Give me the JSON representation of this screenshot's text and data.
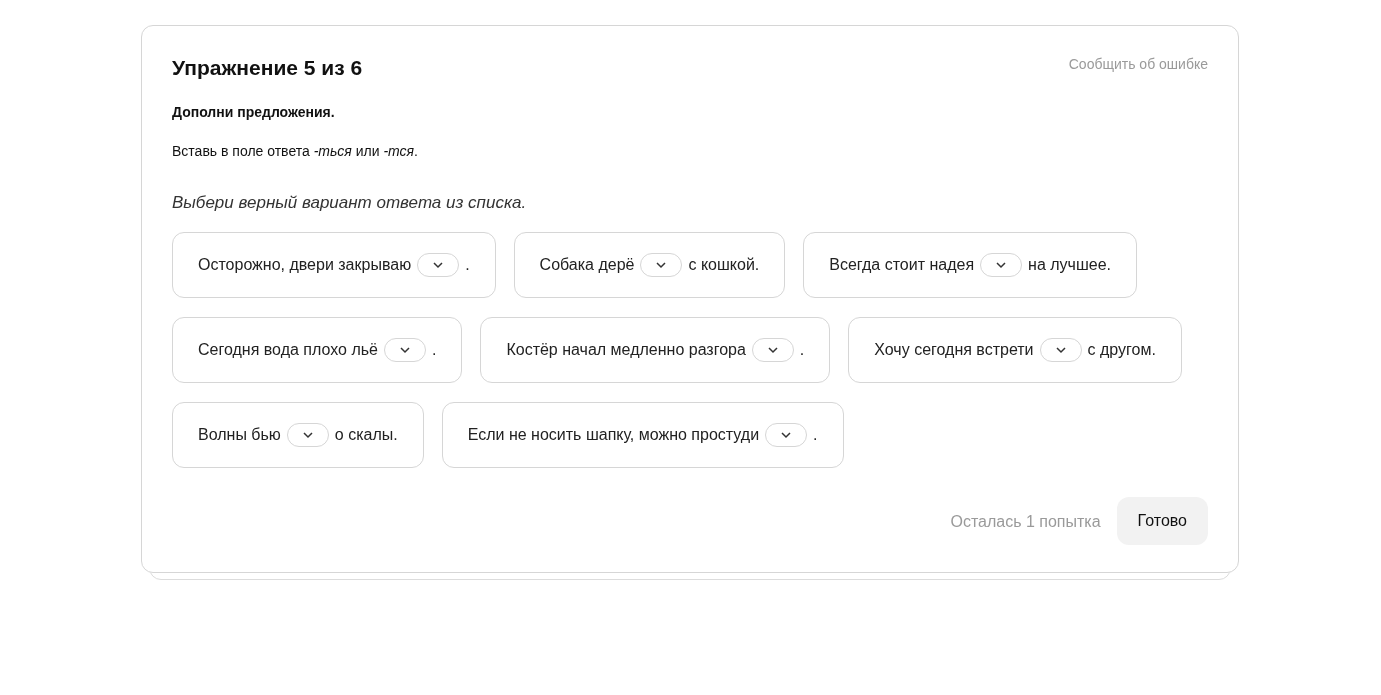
{
  "title": "Упражнение 5 из 6",
  "report_link": "Сообщить об ошибке",
  "task": "Дополни предложения.",
  "instruction": "Вставь в поле ответа *-ться* или *-тся*.",
  "hint": "Выбери верный вариант ответа из списка.",
  "rows": [
    [
      {
        "before": "Осторожно, двери закрываю",
        "after": "."
      },
      {
        "before": "Собака дерё",
        "after": "с кошкой."
      },
      {
        "before": "Всегда стоит надея",
        "after": "на лучшее."
      }
    ],
    [
      {
        "before": "Сегодня вода плохо льё",
        "after": "."
      },
      {
        "before": "Костёр начал медленно разгора",
        "after": "."
      },
      {
        "before": "Хочу сегодня встрети",
        "after": "с другом."
      }
    ],
    [
      {
        "before": "Волны бью",
        "after": "о скалы."
      },
      {
        "before": "Если не носить шапку, можно простуди",
        "after": "."
      }
    ]
  ],
  "attempts": "Осталась 1 попытка",
  "done_button": "Готово"
}
